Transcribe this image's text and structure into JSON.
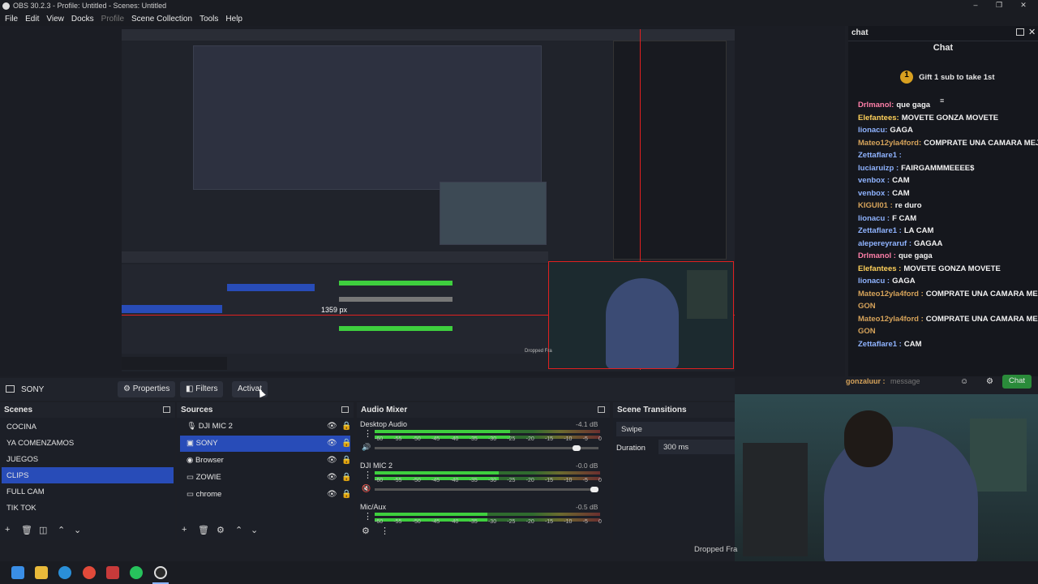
{
  "window": {
    "title": "OBS 30.2.3 - Profile: Untitled - Scenes: Untitled"
  },
  "menu": [
    "File",
    "Edit",
    "View",
    "Docks",
    "Profile",
    "Scene Collection",
    "Tools",
    "Help"
  ],
  "preview": {
    "dimension_label": "1359 px",
    "dropped_frames": "Dropped Fra"
  },
  "chat": {
    "dock_title": "chat",
    "header": "Chat",
    "gift_count": "1",
    "gift_label": "Gift 1 sub to take 1st",
    "messages": [
      {
        "user": "Drlmanol:",
        "text": "que gaga",
        "color": "uc3"
      },
      {
        "user": "Elefantees:",
        "text": "MOVETE GONZA MOVETE",
        "color": "uc4"
      },
      {
        "user": "lionacu:",
        "text": "GAGA",
        "color": "uc2"
      },
      {
        "user": "Mateo12yla4ford:",
        "text": "COMPRATE UNA CAMARA MEJOR GON",
        "color": "uc1"
      },
      {
        "user": "Zettaflare1 :",
        "text": "",
        "color": "uc2"
      },
      {
        "user": "luciaruizp :",
        "text": "FAIRGAMMMEEEE$",
        "color": "uc2"
      },
      {
        "user": "venbox :",
        "text": "CAM",
        "color": "uc2"
      },
      {
        "user": "venbox :",
        "text": "CAM",
        "color": "uc2"
      },
      {
        "user": "KIGUI01 :",
        "text": "re duro",
        "color": "uc1"
      },
      {
        "user": "lionacu :",
        "text": "F CAM",
        "color": "uc2"
      },
      {
        "user": "Zettaflare1 :",
        "text": "LA CAM",
        "color": "uc2"
      },
      {
        "user": "alepereyraruf :",
        "text": "GAGAA",
        "color": "uc2"
      },
      {
        "user": "Drlmanol :",
        "text": "que gaga",
        "color": "uc3"
      },
      {
        "user": "Elefantees :",
        "text": "MOVETE GONZA MOVETE",
        "color": "uc4"
      },
      {
        "user": "lionacu :",
        "text": "GAGA",
        "color": "uc2"
      },
      {
        "user": "Mateo12yla4ford :",
        "text": "COMPRATE UNA CAMARA MEJOR",
        "color": "uc1"
      },
      {
        "user": "GON",
        "text": "",
        "color": "uc1"
      },
      {
        "user": "Mateo12yla4ford :",
        "text": "COMPRATE UNA CAMARA MEJOR",
        "color": "uc1"
      },
      {
        "user": "GON",
        "text": "",
        "color": "uc1"
      },
      {
        "user": "Zettaflare1 :",
        "text": "CAM",
        "color": "uc2"
      }
    ],
    "input_user": "gonzaluur :",
    "input_placeholder": "message",
    "send_label": "Chat"
  },
  "sourcebar": {
    "selected_source": "SONY",
    "properties": "Properties",
    "filters": "Filters",
    "activate": "Activat"
  },
  "scenes": {
    "title": "Scenes",
    "items": [
      "COCINA",
      "YA COMENZAMOS",
      "JUEGOS",
      "CLIPS",
      "FULL CAM",
      "TIK TOK"
    ],
    "selected": "CLIPS"
  },
  "sources": {
    "title": "Sources",
    "items": [
      "DJI MIC 2",
      "SONY",
      "Browser",
      "ZOWIE",
      "chrome"
    ],
    "selected": "SONY"
  },
  "mixer": {
    "title": "Audio Mixer",
    "channels": [
      {
        "name": "Desktop Audio",
        "db": "-4.1 dB",
        "level": 0.6,
        "volume": 0.92
      },
      {
        "name": "DJI MIC 2",
        "db": "-0.0 dB",
        "level": 0.55,
        "volume": 1.0
      },
      {
        "name": "Mic/Aux",
        "db": "-0.5 dB",
        "level": 0.5,
        "volume": null
      }
    ],
    "scale": [
      "-60",
      "-55",
      "-50",
      "-45",
      "-40",
      "-35",
      "-30",
      "-25",
      "-20",
      "-15",
      "-10",
      "-5",
      "0"
    ]
  },
  "transitions": {
    "title": "Scene Transitions",
    "type": "Swipe",
    "duration_label": "Duration",
    "duration_value": "300 ms"
  }
}
